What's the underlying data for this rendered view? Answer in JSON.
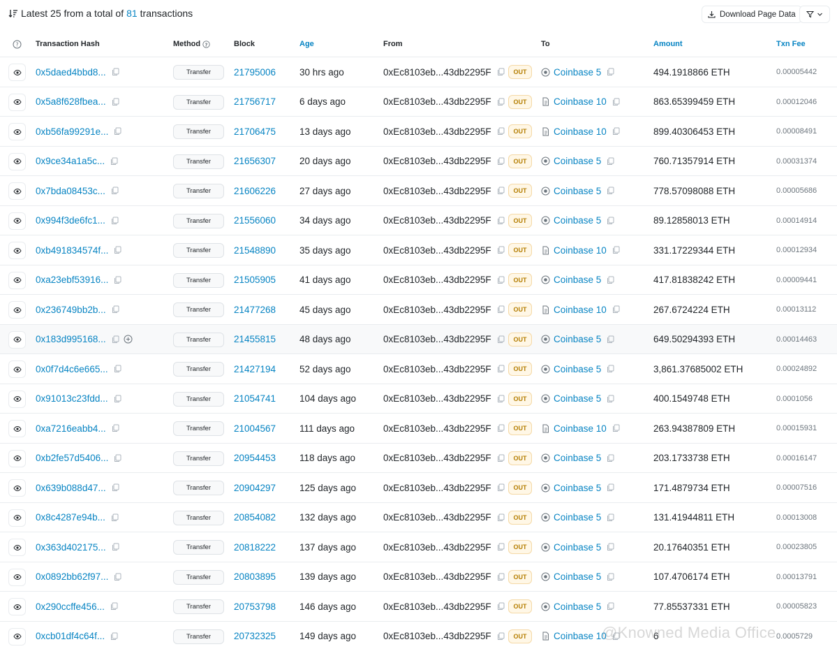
{
  "summary": {
    "prefix": "Latest 25 from a total of",
    "count": "81",
    "suffix": "transactions"
  },
  "toolbar": {
    "download_label": "Download Page Data"
  },
  "columns": {
    "hash": "Transaction Hash",
    "method": "Method",
    "block": "Block",
    "age": "Age",
    "from": "From",
    "to": "To",
    "amount": "Amount",
    "fee": "Txn Fee"
  },
  "colors": {
    "link": "#0784c3",
    "out_badge_bg": "#fff7e6",
    "out_badge_text": "#b47d00"
  },
  "rows": [
    {
      "hash": "0x5daed4bbd8...",
      "method": "Transfer",
      "block": "21795006",
      "age": "30 hrs ago",
      "from": "0xEc8103eb...43db2295F",
      "direction": "OUT",
      "to": "Coinbase 5",
      "to_icon": "eth-address-icon",
      "amount": "494.1918866 ETH",
      "fee": "0.00005442"
    },
    {
      "hash": "0x5a8f628fbea...",
      "method": "Transfer",
      "block": "21756717",
      "age": "6 days ago",
      "from": "0xEc8103eb...43db2295F",
      "direction": "OUT",
      "to": "Coinbase 10",
      "to_icon": "contract-icon",
      "amount": "863.65399459 ETH",
      "fee": "0.00012046"
    },
    {
      "hash": "0xb56fa99291e...",
      "method": "Transfer",
      "block": "21706475",
      "age": "13 days ago",
      "from": "0xEc8103eb...43db2295F",
      "direction": "OUT",
      "to": "Coinbase 10",
      "to_icon": "contract-icon",
      "amount": "899.40306453 ETH",
      "fee": "0.00008491"
    },
    {
      "hash": "0x9ce34a1a5c...",
      "method": "Transfer",
      "block": "21656307",
      "age": "20 days ago",
      "from": "0xEc8103eb...43db2295F",
      "direction": "OUT",
      "to": "Coinbase 5",
      "to_icon": "eth-address-icon",
      "amount": "760.71357914 ETH",
      "fee": "0.00031374"
    },
    {
      "hash": "0x7bda08453c...",
      "method": "Transfer",
      "block": "21606226",
      "age": "27 days ago",
      "from": "0xEc8103eb...43db2295F",
      "direction": "OUT",
      "to": "Coinbase 5",
      "to_icon": "eth-address-icon",
      "amount": "778.57098088 ETH",
      "fee": "0.00005686"
    },
    {
      "hash": "0x994f3de6fc1...",
      "method": "Transfer",
      "block": "21556060",
      "age": "34 days ago",
      "from": "0xEc8103eb...43db2295F",
      "direction": "OUT",
      "to": "Coinbase 5",
      "to_icon": "eth-address-icon",
      "amount": "89.12858013 ETH",
      "fee": "0.00014914"
    },
    {
      "hash": "0xb491834574f...",
      "method": "Transfer",
      "block": "21548890",
      "age": "35 days ago",
      "from": "0xEc8103eb...43db2295F",
      "direction": "OUT",
      "to": "Coinbase 10",
      "to_icon": "contract-icon",
      "amount": "331.17229344 ETH",
      "fee": "0.00012934"
    },
    {
      "hash": "0xa23ebf53916...",
      "method": "Transfer",
      "block": "21505905",
      "age": "41 days ago",
      "from": "0xEc8103eb...43db2295F",
      "direction": "OUT",
      "to": "Coinbase 5",
      "to_icon": "eth-address-icon",
      "amount": "417.81838242 ETH",
      "fee": "0.00009441"
    },
    {
      "hash": "0x236749bb2b...",
      "method": "Transfer",
      "block": "21477268",
      "age": "45 days ago",
      "from": "0xEc8103eb...43db2295F",
      "direction": "OUT",
      "to": "Coinbase 10",
      "to_icon": "contract-icon",
      "amount": "267.6724224 ETH",
      "fee": "0.00013112"
    },
    {
      "hash": "0x183d995168...",
      "method": "Transfer",
      "block": "21455815",
      "age": "48 days ago",
      "from": "0xEc8103eb...43db2295F",
      "direction": "OUT",
      "to": "Coinbase 5",
      "to_icon": "eth-address-icon",
      "amount": "649.50294393 ETH",
      "fee": "0.00014463"
    },
    {
      "hash": "0x0f7d4c6e665...",
      "method": "Transfer",
      "block": "21427194",
      "age": "52 days ago",
      "from": "0xEc8103eb...43db2295F",
      "direction": "OUT",
      "to": "Coinbase 5",
      "to_icon": "eth-address-icon",
      "amount": "3,861.37685002 ETH",
      "fee": "0.00024892"
    },
    {
      "hash": "0x91013c23fdd...",
      "method": "Transfer",
      "block": "21054741",
      "age": "104 days ago",
      "from": "0xEc8103eb...43db2295F",
      "direction": "OUT",
      "to": "Coinbase 5",
      "to_icon": "eth-address-icon",
      "amount": "400.1549748 ETH",
      "fee": "0.0001056"
    },
    {
      "hash": "0xa7216eabb4...",
      "method": "Transfer",
      "block": "21004567",
      "age": "111 days ago",
      "from": "0xEc8103eb...43db2295F",
      "direction": "OUT",
      "to": "Coinbase 10",
      "to_icon": "contract-icon",
      "amount": "263.94387809 ETH",
      "fee": "0.00015931"
    },
    {
      "hash": "0xb2fe57d5406...",
      "method": "Transfer",
      "block": "20954453",
      "age": "118 days ago",
      "from": "0xEc8103eb...43db2295F",
      "direction": "OUT",
      "to": "Coinbase 5",
      "to_icon": "eth-address-icon",
      "amount": "203.1733738 ETH",
      "fee": "0.00016147"
    },
    {
      "hash": "0x639b088d47...",
      "method": "Transfer",
      "block": "20904297",
      "age": "125 days ago",
      "from": "0xEc8103eb...43db2295F",
      "direction": "OUT",
      "to": "Coinbase 5",
      "to_icon": "eth-address-icon",
      "amount": "171.4879734 ETH",
      "fee": "0.00007516"
    },
    {
      "hash": "0x8c4287e94b...",
      "method": "Transfer",
      "block": "20854082",
      "age": "132 days ago",
      "from": "0xEc8103eb...43db2295F",
      "direction": "OUT",
      "to": "Coinbase 5",
      "to_icon": "eth-address-icon",
      "amount": "131.41944811 ETH",
      "fee": "0.00013008"
    },
    {
      "hash": "0x363d402175...",
      "method": "Transfer",
      "block": "20818222",
      "age": "137 days ago",
      "from": "0xEc8103eb...43db2295F",
      "direction": "OUT",
      "to": "Coinbase 5",
      "to_icon": "eth-address-icon",
      "amount": "20.17640351 ETH",
      "fee": "0.00023805"
    },
    {
      "hash": "0x0892bb62f97...",
      "method": "Transfer",
      "block": "20803895",
      "age": "139 days ago",
      "from": "0xEc8103eb...43db2295F",
      "direction": "OUT",
      "to": "Coinbase 5",
      "to_icon": "eth-address-icon",
      "amount": "107.4706174 ETH",
      "fee": "0.00013791"
    },
    {
      "hash": "0x290ccffe456...",
      "method": "Transfer",
      "block": "20753798",
      "age": "146 days ago",
      "from": "0xEc8103eb...43db2295F",
      "direction": "OUT",
      "to": "Coinbase 5",
      "to_icon": "eth-address-icon",
      "amount": "77.85537331 ETH",
      "fee": "0.00005823"
    },
    {
      "hash": "0xcb01df4c64f...",
      "method": "Transfer",
      "block": "20732325",
      "age": "149 days ago",
      "from": "0xEc8103eb...43db2295F",
      "direction": "OUT",
      "to": "Coinbase 10",
      "to_icon": "contract-icon",
      "amount": "6",
      "fee": "0.0005729"
    }
  ],
  "watermark": "@Knowned Media Office"
}
